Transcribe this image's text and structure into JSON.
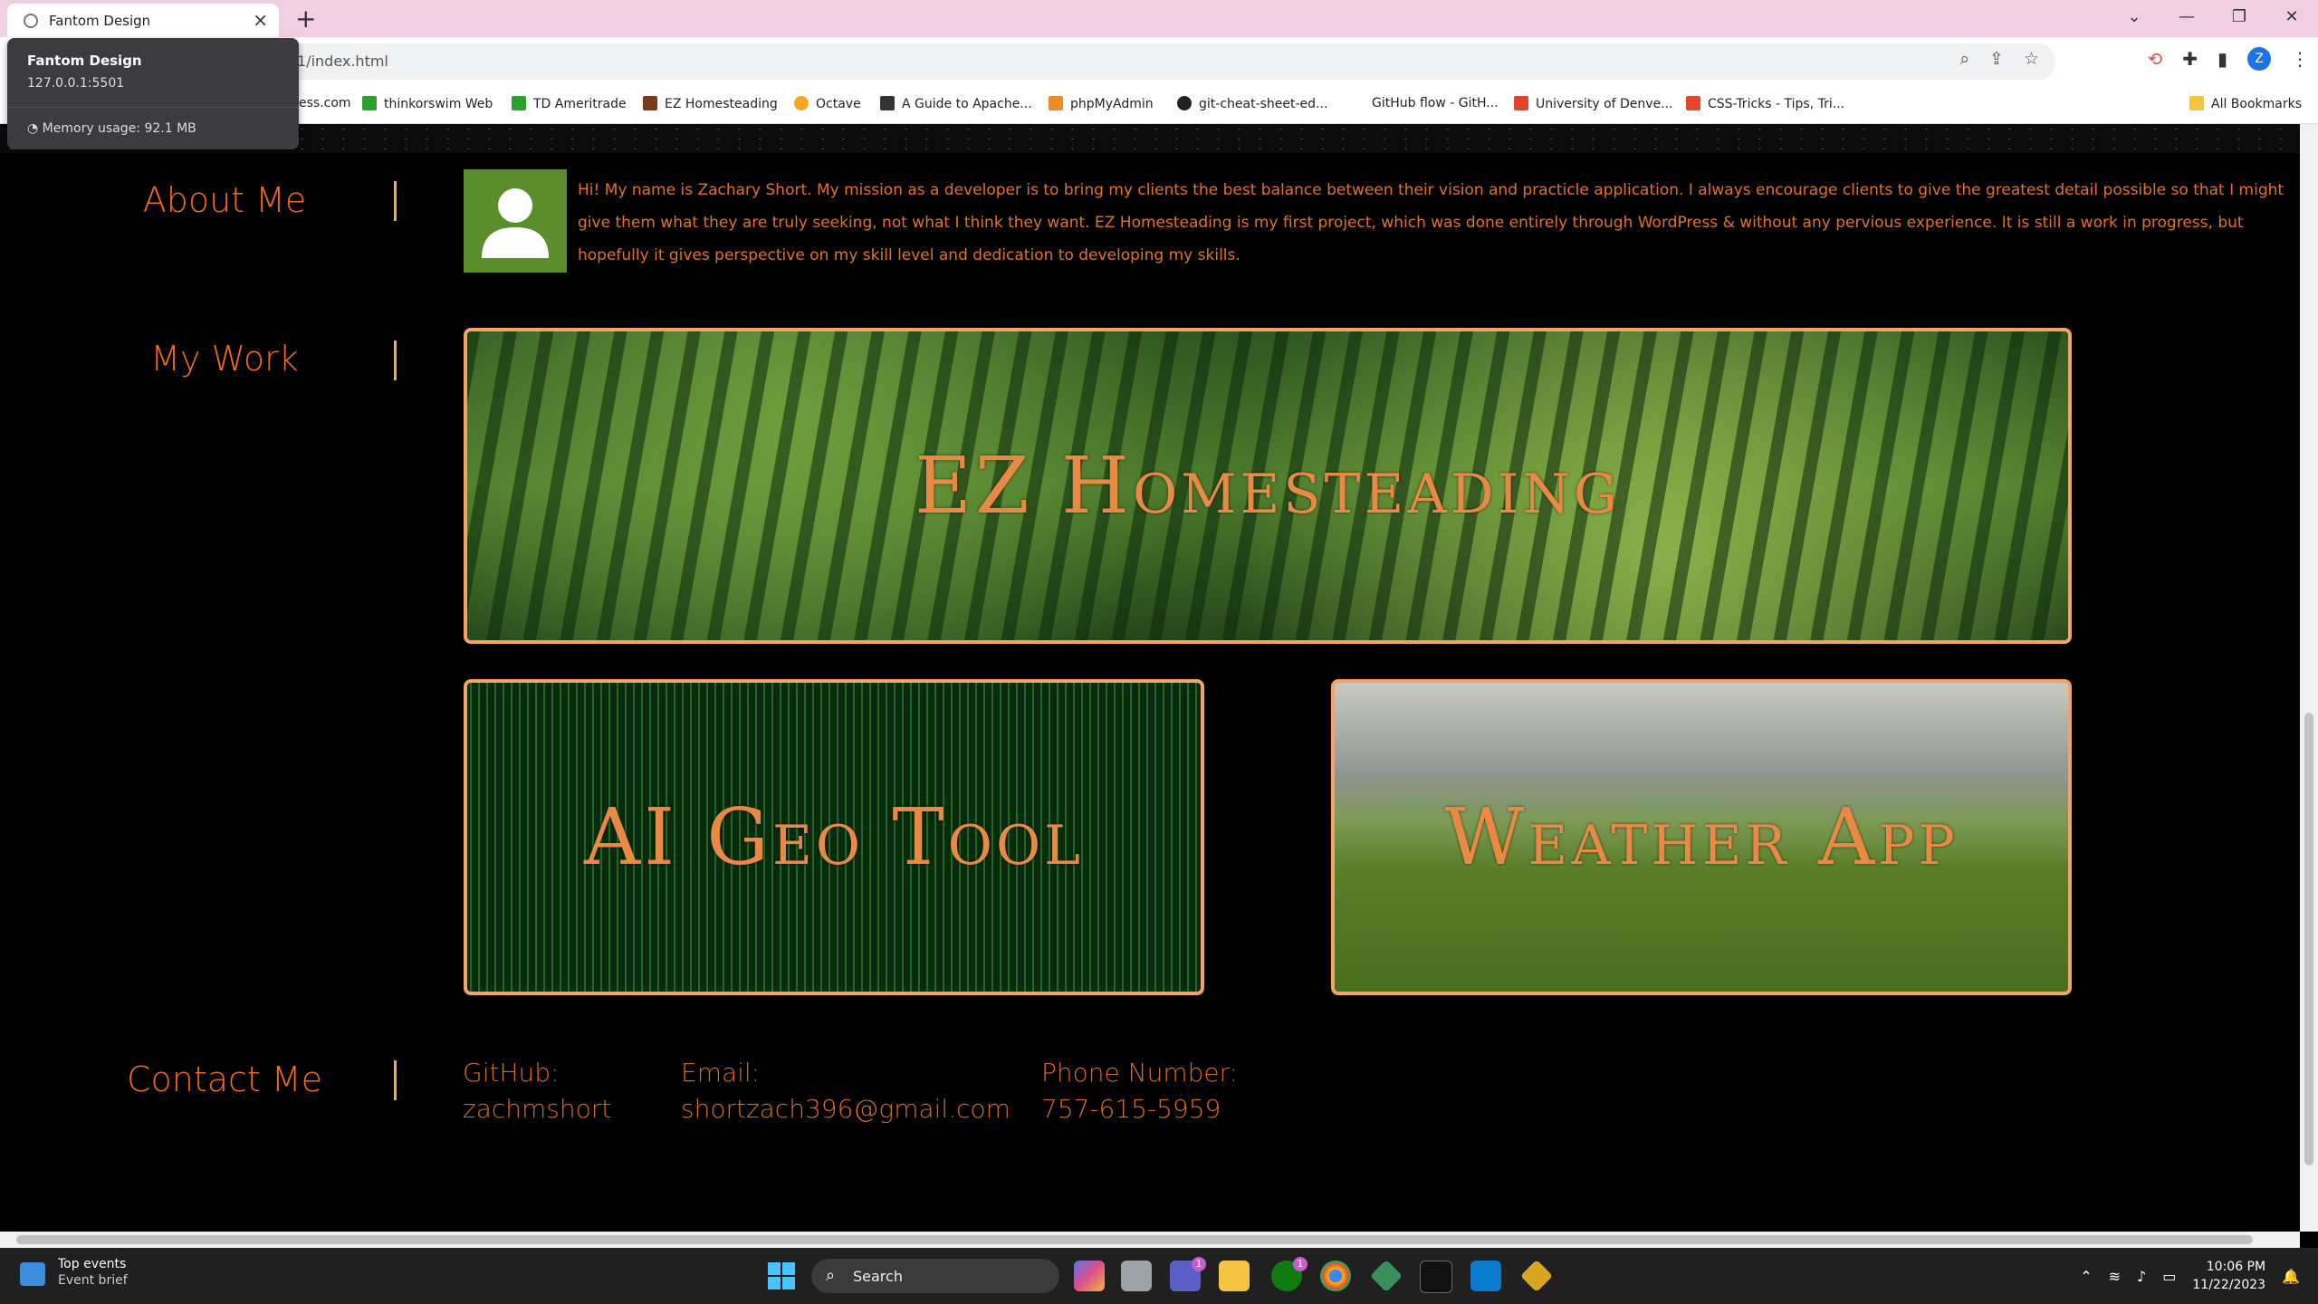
{
  "tab": {
    "title": "Fantom Design",
    "close": "×",
    "new": "+"
  },
  "window_controls": [
    "⌄",
    "—",
    "❐",
    "✕"
  ],
  "omnibox": {
    "url": "1/index.html"
  },
  "toolbar_right": {
    "profile": "Z"
  },
  "bookmarks": [
    {
      "label": "ess.com",
      "color": "#ffffff"
    },
    {
      "label": "thinkorswim Web",
      "color": "#2ca02c"
    },
    {
      "label": "TD Ameritrade",
      "color": "#2ca02c"
    },
    {
      "label": "EZ Homesteading",
      "color": "#7a3b1b"
    },
    {
      "label": "Octave",
      "color": "#f5a623"
    },
    {
      "label": "A Guide to Apache...",
      "color": "#333333"
    },
    {
      "label": "phpMyAdmin",
      "color": "#f08a24"
    },
    {
      "label": "git-cheat-sheet-ed...",
      "color": "#222222"
    },
    {
      "label": "GitHub flow - GitH...",
      "color": "#ffffff"
    },
    {
      "label": "University of Denve...",
      "color": "#e24329"
    },
    {
      "label": "CSS-Tricks - Tips, Tri...",
      "color": "#e2462d"
    }
  ],
  "all_bookmarks": "All Bookmarks",
  "hovercard": {
    "title": "Fantom Design",
    "url": "127.0.0.1:5501",
    "memory": "Memory usage: 92.1 MB"
  },
  "sections": {
    "about": {
      "title": "About Me",
      "text": "Hi! My name is Zachary Short. My mission as a developer is to bring my clients the best balance between their vision and practicle application. I always encourage clients to give the greatest detail possible so that I might give them what they are truly seeking, not what I think they want. EZ Homesteading is my first project, which was done entirely through WordPress & without any pervious experience. It is still a work in progress, but hopefully it gives perspective on my skill level and dedication to developing my skills."
    },
    "work": {
      "title": "My Work",
      "projects": [
        {
          "label": "EZ Homesteading"
        },
        {
          "label": "AI Geo Tool"
        },
        {
          "label": "Weather App"
        }
      ]
    },
    "contact": {
      "title": "Contact Me",
      "github_label": "GitHub:",
      "github_value": "zachmshort",
      "email_label": "Email:",
      "email_value": "shortzach396@gmail.com",
      "phone_label": "Phone Number:",
      "phone_value": "757-615-5959"
    }
  },
  "taskbar": {
    "widget_line1": "Top events",
    "widget_line2": "Event brief",
    "search": "Search",
    "time": "10:06 PM",
    "date": "11/22/2023",
    "badge_teams": "1",
    "badge_xbox": "1"
  },
  "colors": {
    "accent": "#f26a1b",
    "card_border": "#f2a366",
    "background": "#000000"
  }
}
